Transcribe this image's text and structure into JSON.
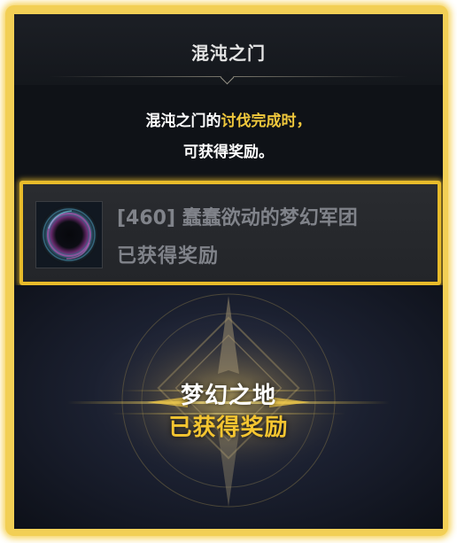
{
  "header": {
    "title": "混沌之门"
  },
  "description": {
    "prefix": "混沌之门的",
    "highlight": "讨伐完成时，",
    "line2": "可获得奖励。"
  },
  "reward": {
    "title": "[460] 蠢蠢欲动的梦幻军团",
    "status": "已获得奖励",
    "icon": "dark-vortex-icon"
  },
  "emblem": {
    "title": "梦幻之地",
    "status": "已获得奖励",
    "icon": "star-emblem-icon"
  },
  "colors": {
    "frame_gold": "#f2cf55",
    "highlight_gold": "#f0c83c",
    "status_gold": "#f4c531",
    "panel_bg": "#0f1217",
    "muted_text": "#80838a"
  }
}
